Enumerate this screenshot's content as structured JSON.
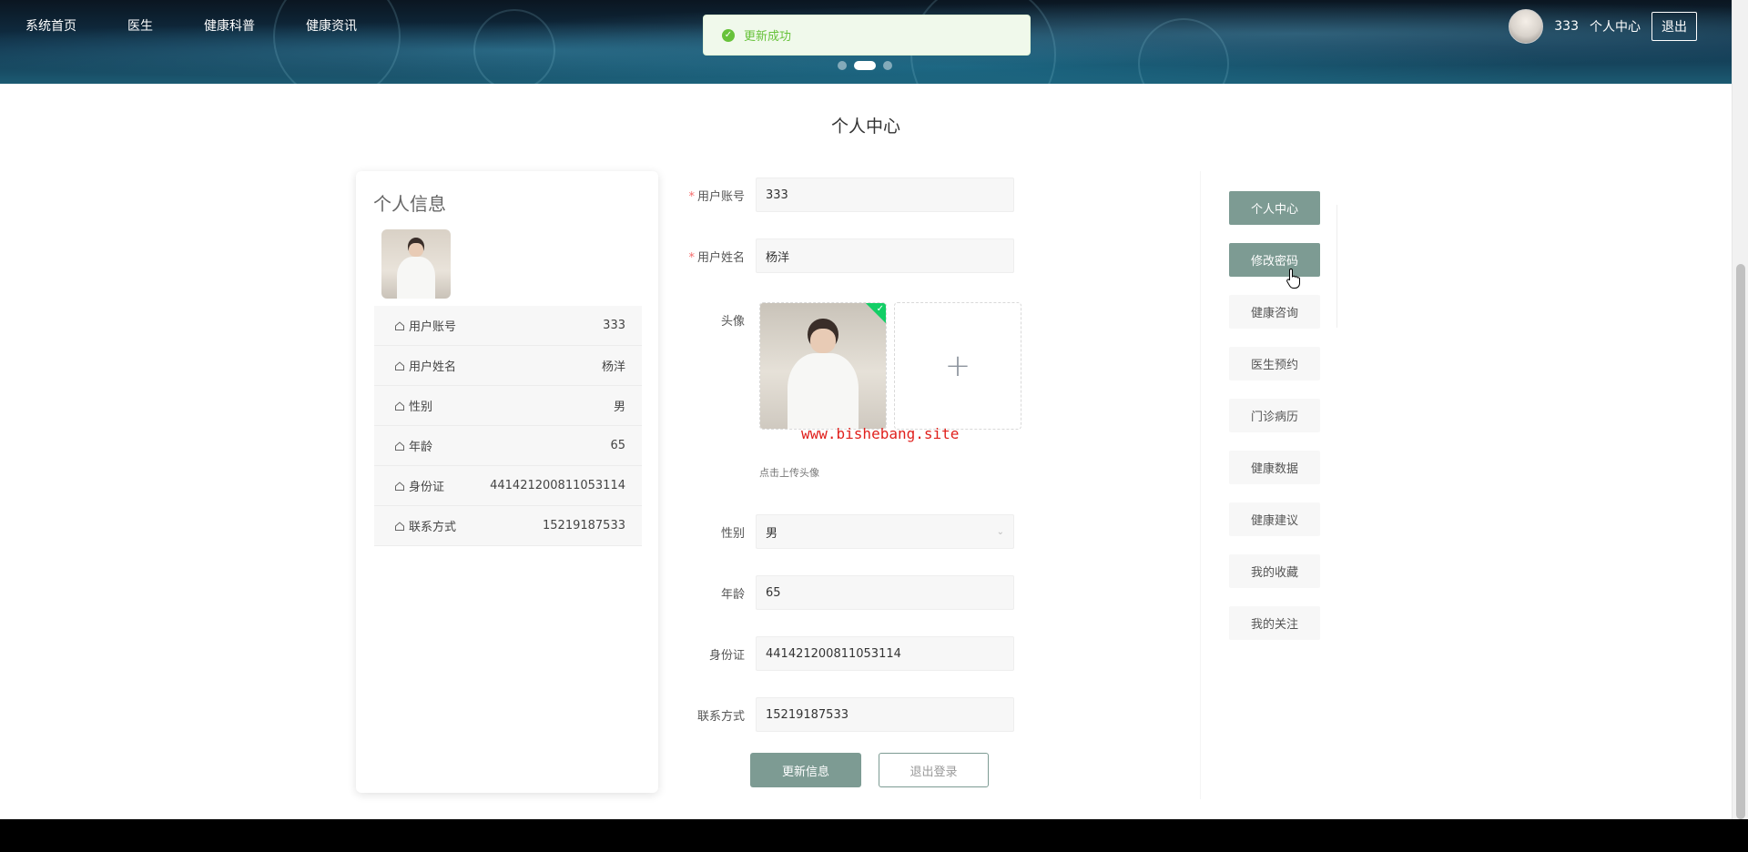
{
  "nav": {
    "items": [
      "系统首页",
      "医生",
      "健康科普",
      "健康资讯"
    ]
  },
  "toast": {
    "message": "更新成功"
  },
  "header_user": {
    "username": "333",
    "center_label": "个人中心",
    "logout_label": "退出"
  },
  "page_title": "个人中心",
  "profile_card": {
    "title": "个人信息",
    "rows": [
      {
        "label": "用户账号",
        "value": "333"
      },
      {
        "label": "用户姓名",
        "value": "杨洋"
      },
      {
        "label": "性别",
        "value": "男"
      },
      {
        "label": "年龄",
        "value": "65"
      },
      {
        "label": "身份证",
        "value": "441421200811053114"
      },
      {
        "label": "联系方式",
        "value": "15219187533"
      }
    ]
  },
  "form": {
    "account": {
      "label": "用户账号",
      "value": "333"
    },
    "name": {
      "label": "用户姓名",
      "value": "杨洋"
    },
    "avatar": {
      "label": "头像",
      "hint": "点击上传头像"
    },
    "gender": {
      "label": "性别",
      "value": "男"
    },
    "age": {
      "label": "年龄",
      "value": "65"
    },
    "id_card": {
      "label": "身份证",
      "value": "441421200811053114"
    },
    "contact": {
      "label": "联系方式",
      "value": "15219187533"
    },
    "update_button": "更新信息",
    "logout_button": "退出登录"
  },
  "watermark": "www.bishebang.site",
  "right_menu": {
    "items": [
      "个人中心",
      "修改密码",
      "健康咨询",
      "医生预约",
      "门诊病历",
      "健康数据",
      "健康建议",
      "我的收藏",
      "我的关注"
    ],
    "active_indices": [
      0,
      1
    ]
  },
  "colors": {
    "accent": "#7d9b93",
    "success": "#67c23a",
    "required": "#f56c6c",
    "watermark": "#e0201c"
  }
}
